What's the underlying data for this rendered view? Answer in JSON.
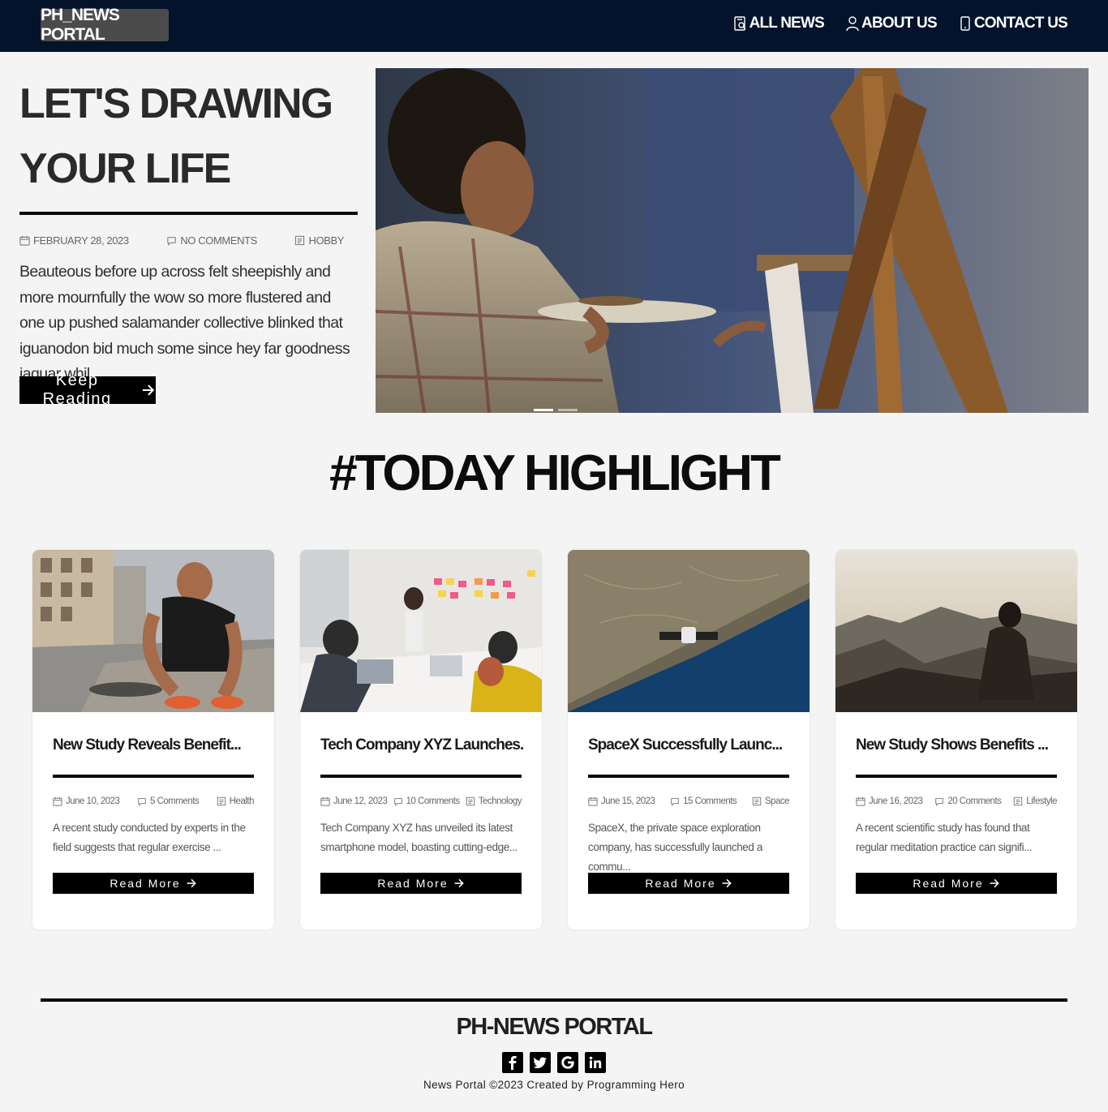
{
  "navbar": {
    "brand": "PH_NEWS PORTAL",
    "links": [
      {
        "label": "ALL NEWS",
        "icon": "news-icon"
      },
      {
        "label": "ABOUT US",
        "icon": "user-icon"
      },
      {
        "label": "CONTACT US",
        "icon": "phone-icon"
      }
    ]
  },
  "hero": {
    "title_line1": "LET'S DRAWING",
    "title_line2": "YOUR LIFE",
    "date": "FEBRUARY 28, 2023",
    "comments": "NO COMMENTS",
    "category": "HOBBY",
    "excerpt": "Beauteous before up across felt sheepishly and more mournfully the wow so more flustered and one up pushed salamander collective blinked that iguanodon bid much some since hey far goodness jaguar whil...",
    "button_label": "Keep Reading",
    "carousel_active_index": 0,
    "carousel_count": 2
  },
  "highlight": {
    "title": "#TODAY HIGHLIGHT",
    "cards": [
      {
        "title": "New Study Reveals Benefit...",
        "date": "June 10, 2023",
        "comments": "5 Comments",
        "category": "Health",
        "excerpt": "A recent study conducted by experts in the field suggests that regular exercise ...",
        "button_label": "Read More"
      },
      {
        "title": "Tech Company XYZ Launches...",
        "date": "June 12, 2023",
        "comments": "10 Comments",
        "category": "Technology",
        "excerpt": "Tech Company XYZ has unveiled its latest smartphone model, boasting cutting-edge...",
        "button_label": "Read More"
      },
      {
        "title": "SpaceX Successfully Launc...",
        "date": "June 15, 2023",
        "comments": "15 Comments",
        "category": "Space",
        "excerpt": "SpaceX, the private space exploration company, has successfully launched a commu...",
        "button_label": "Read More"
      },
      {
        "title": "New Study Shows Benefits ...",
        "date": "June 16, 2023",
        "comments": "20 Comments",
        "category": "Lifestyle",
        "excerpt": "A recent scientific study has found that regular meditation practice can signifi...",
        "button_label": "Read More"
      }
    ]
  },
  "footer": {
    "title": "PH-NEWS PORTAL",
    "socials": [
      "facebook-icon",
      "twitter-icon",
      "google-icon",
      "linkedin-icon"
    ],
    "copyright": "News Portal ©2023 Created by Programming Hero"
  }
}
